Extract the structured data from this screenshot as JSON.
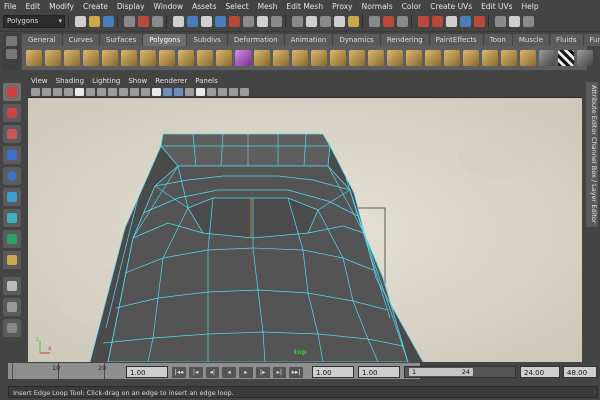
{
  "menubar": {
    "items": [
      "File",
      "Edit",
      "Modify",
      "Create",
      "Display",
      "Window",
      "Assets",
      "Select",
      "Mesh",
      "Edit Mesh",
      "Proxy",
      "Normals",
      "Color",
      "Create UVs",
      "Edit UVs",
      "Help"
    ]
  },
  "statusline": {
    "mode_value": "Polygons"
  },
  "shelf": {
    "tabs": [
      "General",
      "Curves",
      "Surfaces",
      "Polygons",
      "Subdivs",
      "Deformation",
      "Animation",
      "Dynamics",
      "Rendering",
      "PaintEffects",
      "Toon",
      "Muscle",
      "Fluids",
      "Fur"
    ],
    "active_tab": "Polygons"
  },
  "panel": {
    "menu_items": [
      "View",
      "Shading",
      "Lighting",
      "Show",
      "Renderer",
      "Panels"
    ],
    "camera_label": "top"
  },
  "side_tabs": [
    "Attribute Editor",
    "Channel Box / Layer Editor"
  ],
  "time_slider": {
    "ticks": [
      "10",
      "20"
    ],
    "current_time": "1.00"
  },
  "playback": {
    "buttons": [
      "|◂◂",
      "|◂",
      "◂|",
      "◂",
      "▸",
      "|▸",
      "▸|",
      "▸▸|"
    ]
  },
  "range_slider": {
    "start_time": "1.00",
    "playback_start": "1.00",
    "range_start": "1",
    "range_end": "24",
    "playback_end": "24.00",
    "end_time": "48.00"
  },
  "helpline": {
    "text": "Insert Edge Loop Tool: Click-drag on an edge to insert an edge loop."
  },
  "colors": {
    "wire": "#55d8ee",
    "mesh_dark": "#4a4a4a",
    "mesh_top": "#5a5a5a",
    "background": "#ddd9cc"
  }
}
